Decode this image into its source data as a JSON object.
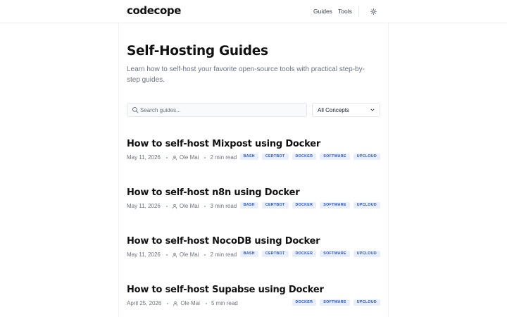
{
  "header": {
    "logo": "codecope",
    "nav": [
      {
        "label": "Guides"
      },
      {
        "label": "Tools"
      }
    ],
    "theme_icon": "sun-icon"
  },
  "hero": {
    "title": "Self-Hosting Guides",
    "subtitle": "Learn how to self-host your favorite open-source tools with practical step-by-step guides."
  },
  "filters": {
    "search_placeholder": "Search guides...",
    "concept_select": "All Concepts"
  },
  "articles": [
    {
      "title": "How to self-host Mixpost using Docker",
      "date": "May 11, 2026",
      "author": "Ole Mai",
      "read_time": "2 min read",
      "tags": [
        "BASH",
        "CERTBOT",
        "DOCKER",
        "SOFTWARE",
        "UPCLOUD"
      ]
    },
    {
      "title": "How to self-host n8n using Docker",
      "date": "May 11, 2026",
      "author": "Ole Mai",
      "read_time": "3 min read",
      "tags": [
        "BASH",
        "CERTBOT",
        "DOCKER",
        "SOFTWARE",
        "UPCLOUD"
      ]
    },
    {
      "title": "How to self-host NocoDB using Docker",
      "date": "May 11, 2026",
      "author": "Ole Mai",
      "read_time": "2 min read",
      "tags": [
        "BASH",
        "CERTBOT",
        "DOCKER",
        "SOFTWARE",
        "UPCLOUD"
      ]
    },
    {
      "title": "How to self-host Supabse using Docker",
      "date": "April 25, 2026",
      "author": "Ole Mai",
      "read_time": "5 min read",
      "tags": [
        "DOCKER",
        "SOFTWARE",
        "UPCLOUD"
      ]
    }
  ],
  "colors": {
    "tag_bg": "#e8eefc",
    "tag_text": "#2457d6"
  }
}
